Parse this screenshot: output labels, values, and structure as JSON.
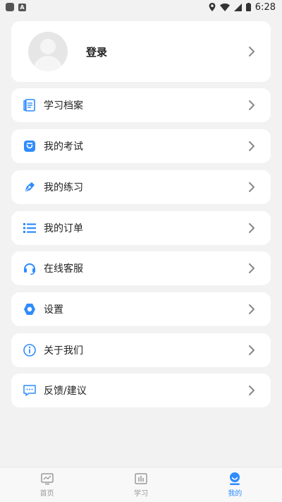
{
  "status_bar": {
    "time": "6:28",
    "badge_letter": "A"
  },
  "profile": {
    "login_label": "登录"
  },
  "menu": [
    {
      "label": "学习档案",
      "icon": "document-icon"
    },
    {
      "label": "我的考试",
      "icon": "exam-icon"
    },
    {
      "label": "我的练习",
      "icon": "pen-icon"
    },
    {
      "label": "我的订单",
      "icon": "list-icon"
    },
    {
      "label": "在线客服",
      "icon": "headset-icon"
    },
    {
      "label": "设置",
      "icon": "settings-icon"
    },
    {
      "label": "关于我们",
      "icon": "info-icon"
    },
    {
      "label": "反馈/建议",
      "icon": "feedback-icon"
    }
  ],
  "tabs": [
    {
      "label": "首页",
      "icon": "home-icon",
      "active": false
    },
    {
      "label": "学习",
      "icon": "study-icon",
      "active": false
    },
    {
      "label": "我的",
      "icon": "profile-icon",
      "active": true
    }
  ],
  "colors": {
    "accent": "#2f8cff",
    "background": "#f2f2f2",
    "card": "#ffffff",
    "inactive_tab": "#999999"
  }
}
